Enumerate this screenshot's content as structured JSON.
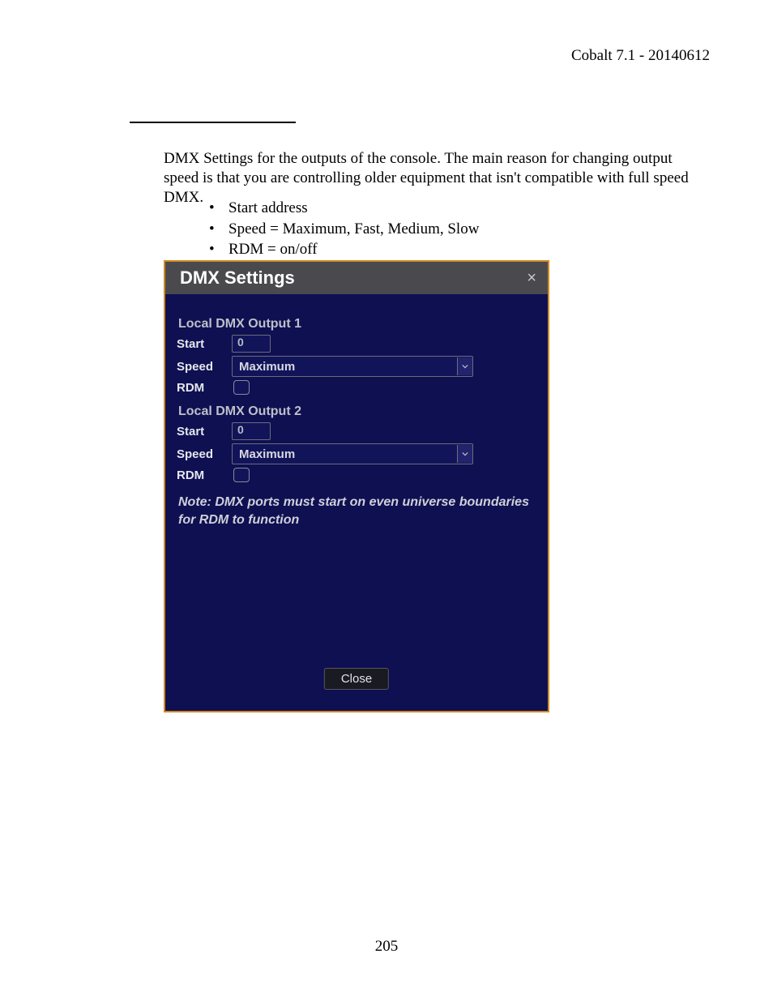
{
  "header": {
    "right": "Cobalt 7.1 - 20140612"
  },
  "intro": "DMX Settings for the outputs of the console. The main reason for changing output speed is that you are controlling older equipment that isn't compatible with full speed DMX.",
  "bullets": [
    "Start address",
    "Speed = Maximum, Fast, Medium, Slow",
    "RDM = on/off"
  ],
  "dialog": {
    "title": "DMX Settings",
    "outputs": [
      {
        "heading": "Local DMX Output 1",
        "labels": {
          "start": "Start",
          "speed": "Speed",
          "rdm": "RDM"
        },
        "start": "0",
        "speed": "Maximum",
        "rdm": false
      },
      {
        "heading": "Local DMX Output 2",
        "labels": {
          "start": "Start",
          "speed": "Speed",
          "rdm": "RDM"
        },
        "start": "0",
        "speed": "Maximum",
        "rdm": false
      }
    ],
    "note": "Note: DMX ports must start on even universe boundaries for RDM to function",
    "close": "Close"
  },
  "page_number": "205"
}
